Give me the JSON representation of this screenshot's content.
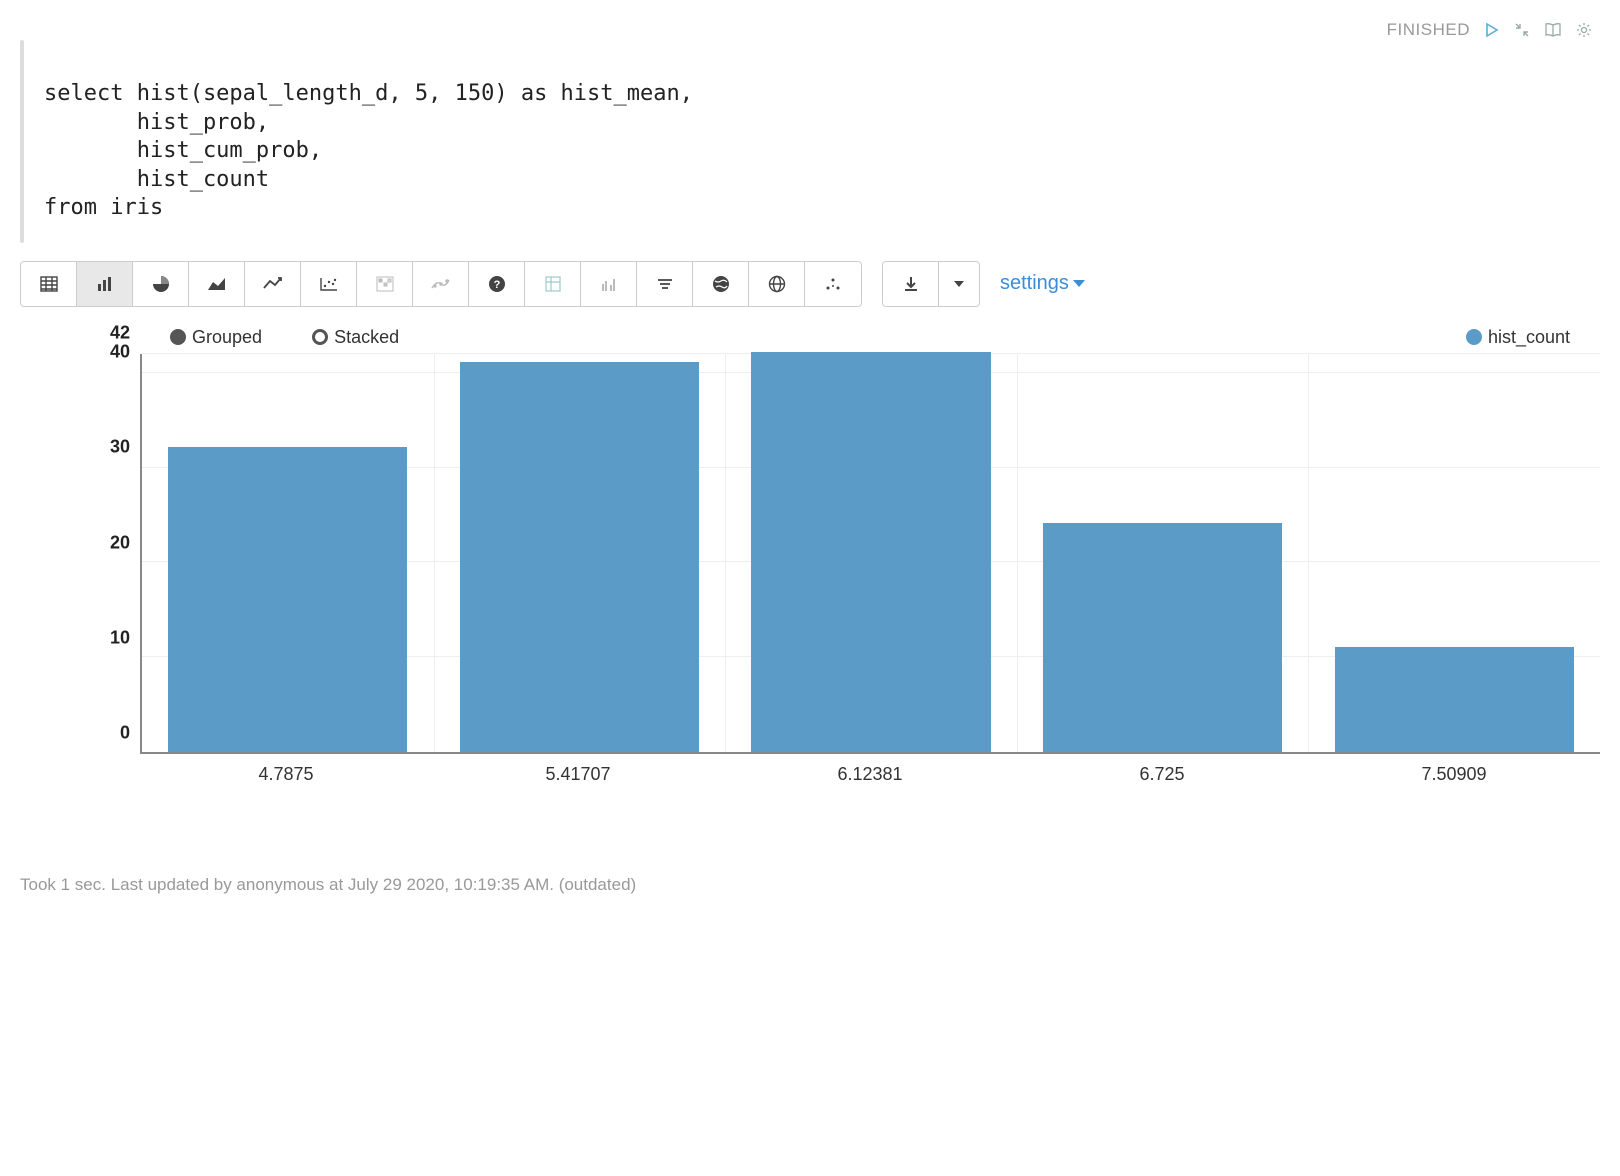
{
  "status": {
    "text": "FINISHED"
  },
  "code": "select hist(sepal_length_d, 5, 150) as hist_mean,\n       hist_prob,\n       hist_cum_prob,\n       hist_count\nfrom iris",
  "toolbar": {
    "settings_label": "settings"
  },
  "legend": {
    "grouped": "Grouped",
    "stacked": "Stacked",
    "series": "hist_count"
  },
  "chart_data": {
    "type": "bar",
    "categories": [
      "4.7875",
      "5.41707",
      "6.12381",
      "6.725",
      "7.50909"
    ],
    "values": [
      32,
      41,
      42,
      24,
      11
    ],
    "series_name": "hist_count",
    "ylabel": "",
    "xlabel": "",
    "ylim": [
      0,
      42
    ],
    "y_ticks": [
      0,
      10,
      20,
      30,
      40,
      42
    ]
  },
  "footer": {
    "text": "Took 1 sec. Last updated by anonymous at July 29 2020, 10:19:35 AM. (outdated)"
  }
}
